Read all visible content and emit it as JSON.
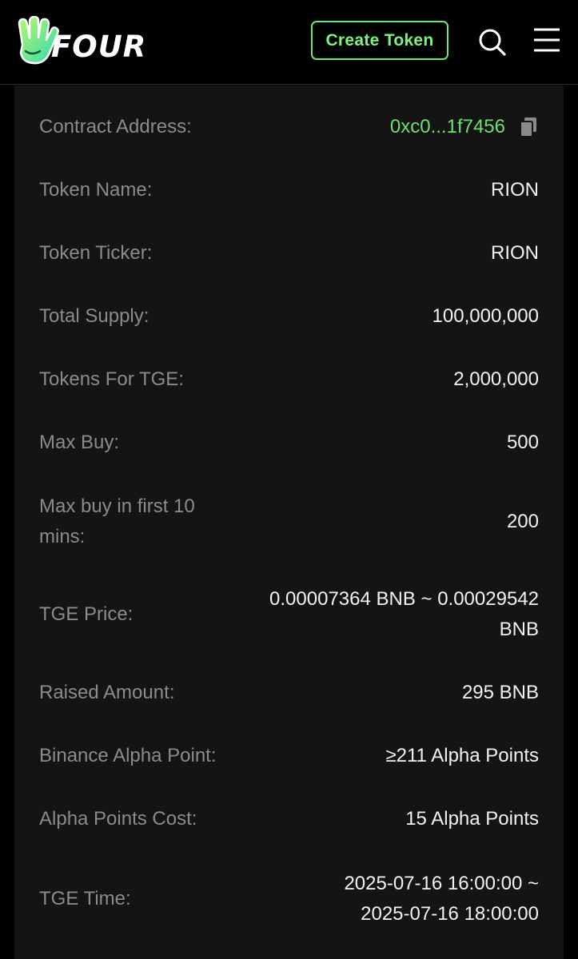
{
  "header": {
    "logo_text": "FOUR",
    "create_button": "Create Token",
    "search_icon": "search-icon",
    "menu_icon": "hamburger-menu-icon",
    "accent_color": "#6ee86e"
  },
  "details": {
    "contract_address": {
      "label": "Contract Address:",
      "value": "0xc0...1f7456",
      "copy_icon": "copy-icon"
    },
    "token_name": {
      "label": "Token Name:",
      "value": "RION"
    },
    "token_ticker": {
      "label": "Token Ticker:",
      "value": "RION"
    },
    "total_supply": {
      "label": "Total Supply:",
      "value": "100,000,000"
    },
    "tokens_for_tge": {
      "label": "Tokens For TGE:",
      "value": "2,000,000"
    },
    "max_buy": {
      "label": "Max Buy:",
      "value": "500"
    },
    "max_buy_first_10": {
      "label": "Max buy in first 10 mins:",
      "value": "200"
    },
    "tge_price": {
      "label": "TGE Price:",
      "value": "0.00007364 BNB ~ 0.00029542 BNB"
    },
    "raised_amount": {
      "label": "Raised Amount:",
      "value": "295 BNB"
    },
    "alpha_point": {
      "label": "Binance Alpha Point:",
      "value": "≥211 Alpha Points"
    },
    "alpha_cost": {
      "label": "Alpha Points Cost:",
      "value": "15 Alpha Points"
    },
    "tge_time": {
      "label": "TGE Time:",
      "value": "2025-07-16 16:00:00 ~ 2025-07-16 18:00:00"
    }
  }
}
